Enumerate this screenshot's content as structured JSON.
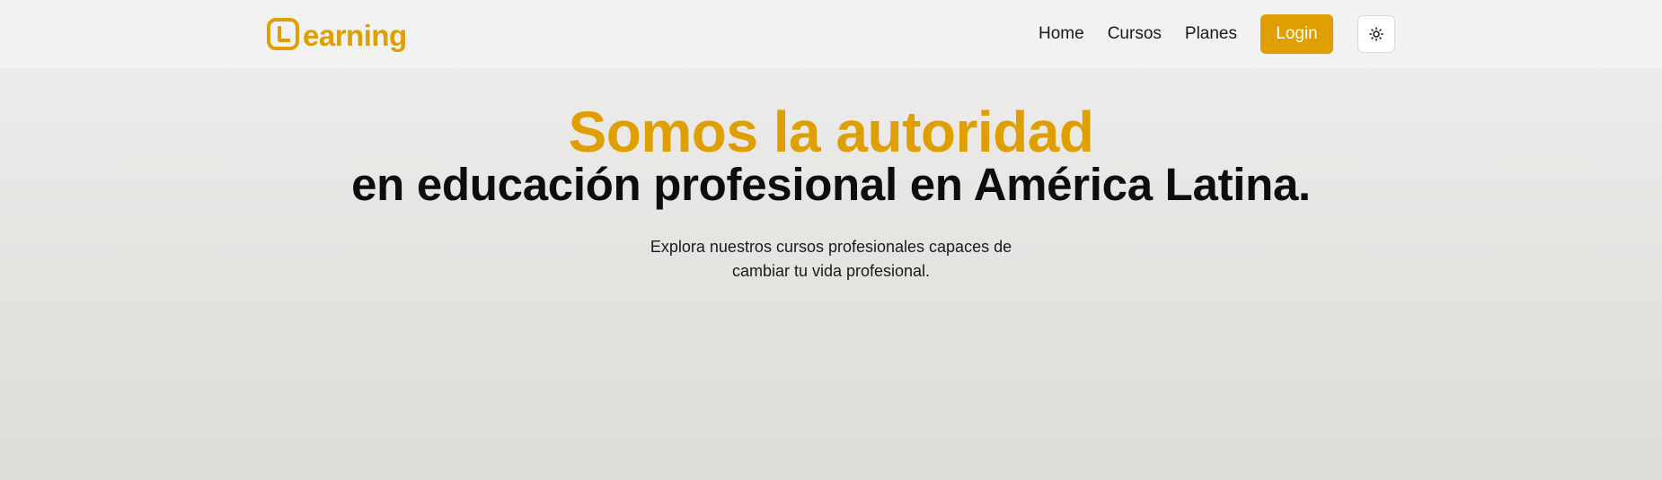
{
  "brand": {
    "name": "earning",
    "mark_letter": "L",
    "color": "#df9f00"
  },
  "nav": {
    "links": [
      {
        "label": "Home"
      },
      {
        "label": "Cursos"
      },
      {
        "label": "Planes"
      }
    ],
    "login_label": "Login",
    "theme_toggle_icon": "sun-icon"
  },
  "hero": {
    "title_accent": "Somos la autoridad",
    "title_main": "en educación profesional en América Latina.",
    "subtitle": "Explora nuestros cursos profesionales capaces de cambiar tu vida profesional."
  },
  "colors": {
    "accent": "#df9f00",
    "text": "#0d0d0d",
    "navbar_bg": "#f2f2f2"
  }
}
